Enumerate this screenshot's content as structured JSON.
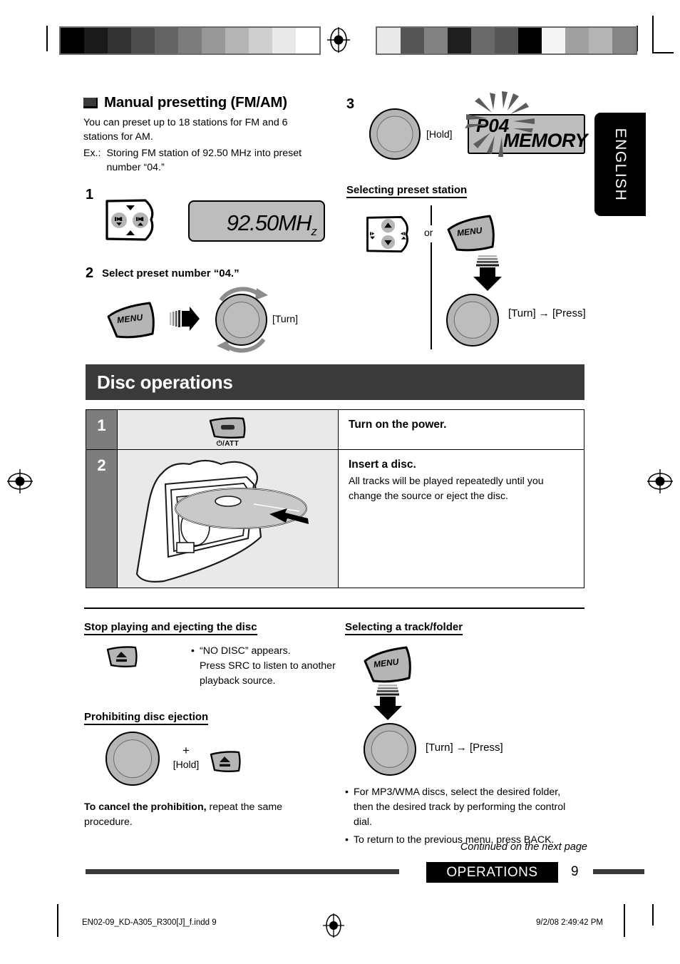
{
  "lang_tab": "ENGLISH",
  "section_manual_preset": {
    "heading": "Manual presetting (FM/AM)",
    "intro": "You can preset up to 18 stations for FM and 6 stations for AM.",
    "ex_label": "Ex.:",
    "ex_text": "Storing FM station of 92.50 MHz into preset number “04.”",
    "step1_num": "1",
    "step1_display": "92.50MH",
    "step1_display_sub": "z",
    "step2_num": "2",
    "step2_title": "Select preset number “04.”",
    "step2_menu_key": "MENU",
    "step2_turn": "[Turn]",
    "step3_num": "3",
    "step3_hold": "[Hold]",
    "step3_display_top": "P04",
    "step3_display_bottom": "MEMORY"
  },
  "section_select_preset": {
    "heading": "Selecting preset station",
    "or_label": "or",
    "menu_key": "MENU",
    "turn_press": "[Turn] → [Press]"
  },
  "disc_operations": {
    "band_title": "Disc operations",
    "rows": [
      {
        "num": "1",
        "icon": "power-att-button",
        "icon_label": "⏻/ATT",
        "title": "Turn on the power.",
        "body": ""
      },
      {
        "num": "2",
        "icon": "disc-insert-illustration",
        "icon_label": "",
        "title": "Insert a disc.",
        "body": "All tracks will be played repeatedly until you change the source or eject the disc."
      }
    ]
  },
  "section_stop_eject": {
    "heading": "Stop playing and ejecting the disc",
    "bullets": [
      "“NO DISC” appears.",
      "Press SRC to listen to another",
      "playback source."
    ]
  },
  "section_prohibit": {
    "heading": "Prohibiting disc ejection",
    "plus": "+",
    "hold": "[Hold]",
    "cancel_bold": "To cancel the prohibition,",
    "cancel_rest": " repeat the same procedure."
  },
  "section_select_track": {
    "heading": "Selecting a track/folder",
    "menu_key": "MENU",
    "turn_press": "[Turn] → [Press]",
    "bullets": [
      "For MP3/WMA discs, select the desired folder, then the desired track by performing the control dial.",
      "To return to the previous menu, press BACK."
    ]
  },
  "footer": {
    "continued": "Continued on the next page",
    "chip": "OPERATIONS",
    "page_number": "9"
  },
  "imprint": {
    "file": "EN02-09_KD-A305_R300[J]_f.indd   9",
    "datetime": "9/2/08   2:49:42 PM"
  },
  "colorbars": {
    "left": [
      "#000000",
      "#1a1a1a",
      "#333333",
      "#4d4d4d",
      "#636363",
      "#7c7c7c",
      "#989898",
      "#b4b4b4",
      "#cfcfcf",
      "#e9e9e9",
      "#ffffff"
    ],
    "right": [
      "#e9e9e9",
      "#555555",
      "#828282",
      "#1e1e1e",
      "#6a6a6a",
      "#555555",
      "#000000",
      "#f4f4f4",
      "#a0a0a0",
      "#b4b4b4",
      "#858585"
    ]
  }
}
